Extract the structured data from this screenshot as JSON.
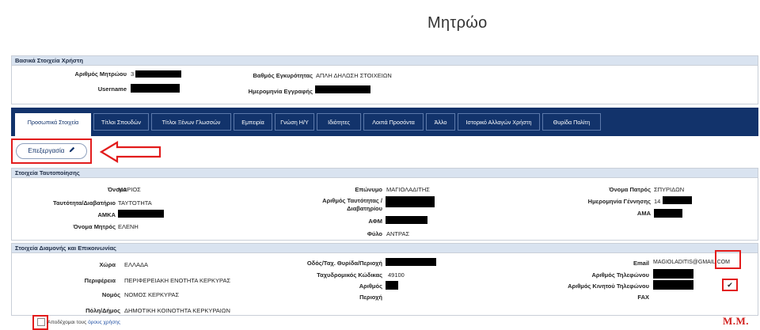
{
  "page": {
    "title": "Μητρώο"
  },
  "basic": {
    "header": "Βασικά Στοιχεία Χρήστη",
    "labels": {
      "registry_number": "Αριθμός Μητρώου",
      "username": "Username",
      "validity_level": "Βαθμός Εγκυρότητας",
      "registration_date": "Ημερομηνία Εγγραφής"
    },
    "values": {
      "registry_number_prefix": "3",
      "validity_level": "ΑΠΛΗ ΔΗΛΩΣΗ ΣΤΟΙΧΕΙΩΝ"
    }
  },
  "tabs": [
    {
      "label": "Προσωπικά Στοιχεία",
      "active": true
    },
    {
      "label": "Τίτλοι Σπουδών"
    },
    {
      "label": "Τίτλοι Ξένων Γλωσσών"
    },
    {
      "label": "Εμπειρία"
    },
    {
      "label": "Γνώση Η/Υ"
    },
    {
      "label": "Ιδιότητες"
    },
    {
      "label": "Λοιπά Προσόντα"
    },
    {
      "label": "Άλλο"
    },
    {
      "label": "Ιστορικό Αλλαγών Χρήστη"
    },
    {
      "label": "Θυρίδα Πολίτη"
    }
  ],
  "edit_button": {
    "label": "Επεξεργασία",
    "icon": "pencil-icon"
  },
  "identity": {
    "header": "Στοιχεία Ταυτοποίησης",
    "labels": {
      "first_name": "Όνομα",
      "id_passport": "Ταυτότητα/Διαβατήριο",
      "amka": "ΑΜΚΑ",
      "mother_name": "Όνομα Μητρός",
      "last_name": "Επώνυμο",
      "id_number_1": "Αριθμός Ταυτότητας /",
      "id_number_2": "Διαβατηρίου",
      "afm": "ΑΦΜ",
      "gender": "Φύλο",
      "father_name": "Όνομα Πατρός",
      "birth_date": "Ημερομηνία Γέννησης",
      "ama": "ΑΜΑ"
    },
    "values": {
      "first_name": "ΜΑΡΙΟΣ",
      "id_passport": "ΤΑΥΤΟΤΗΤΑ",
      "mother_name": "ΕΛΕΝΗ",
      "last_name": "ΜΑΓΙΟΛΑΔΙΤΗΣ",
      "gender": "ΑΝΤΡΑΣ",
      "father_name": "ΣΠΥΡΙΔΩΝ",
      "birth_date_prefix": "14"
    }
  },
  "contact": {
    "header": "Στοιχεία Διαμονής και Επικοινωνίας",
    "labels": {
      "country": "Χώρα",
      "region": "Περιφέρεια",
      "prefecture": "Νομός",
      "municipality": "Πόλη/Δήμος",
      "street": "Οδός/Ταχ. Θυρίδα/Περιοχή",
      "postal_code": "Ταχυδρομικός Κώδικας",
      "number": "Αριθμός",
      "area": "Περιοχή",
      "email": "Email",
      "phone": "Αριθμός Τηλεφώνου",
      "mobile": "Αριθμός Κινητού Τηλεφώνου",
      "fax": "FAX"
    },
    "values": {
      "country": "ΕΛΛΑΔΑ",
      "region": "ΠΕΡΙΦΕΡΕΙΑΚΗ ΕΝΟΤΗΤΑ ΚΕΡΚΥΡΑΣ",
      "prefecture": "ΝΟΜΟΣ ΚΕΡΚΥΡΑΣ",
      "municipality": "ΔΗΜΟΤΙΚΗ ΚΟΙΝΟΤΗΤΑ ΚΕΡΚΥΡΑΙΩΝ",
      "postal_code": "49100",
      "email": "MAGIOLADITIS@GMAIL.COM"
    }
  },
  "terms": {
    "prefix": "Αποδέχομαι τους ",
    "link": "όρους χρήσης"
  },
  "watermark": "Μ.Μ.",
  "colors": {
    "nav_bg": "#12336b",
    "header_bg": "#d9e3f0",
    "highlight": "#e21c1c"
  }
}
